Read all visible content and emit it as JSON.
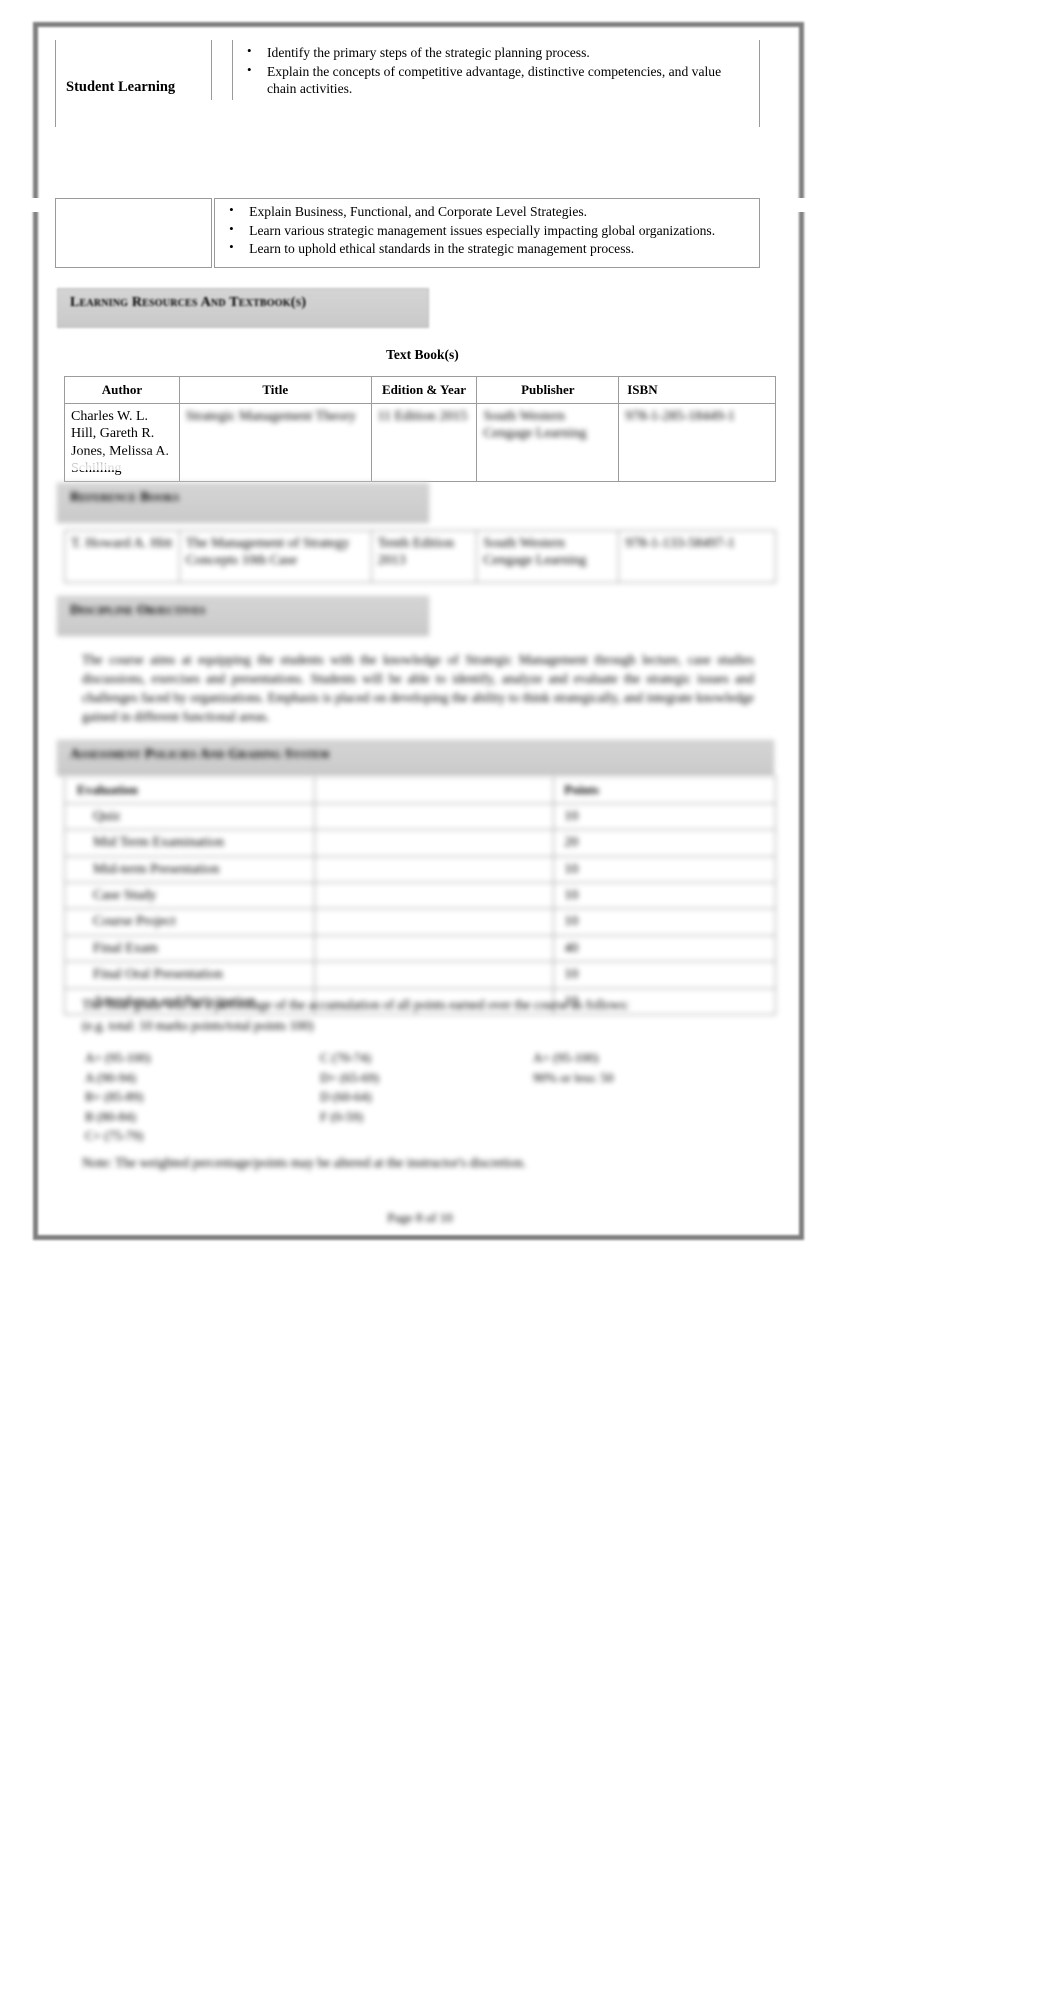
{
  "document": {
    "type": "course-syllabus-page",
    "page_number": "Page 8 of 10"
  },
  "learning_outcomes": {
    "label": "Student Learning Outcomes",
    "group1": [
      "Identify the primary steps of the strategic planning process.",
      "Explain the concepts of competitive advantage, distinctive competencies, and value chain activities."
    ],
    "group2": [
      "Explain Business, Functional, and Corporate Level Strategies.",
      "Learn various strategic management issues especially impacting global organizations.",
      "Learn to uphold ethical standards in the strategic management process."
    ]
  },
  "resources": {
    "section_title": "Learning Resources And Textbook(s)",
    "textbook_caption": "Text Book(s)",
    "columns": [
      "Author",
      "Title",
      "Edition & Year",
      "Publisher",
      "ISBN"
    ],
    "textbook_rows": [
      {
        "author": "Charles W. L. Hill, Gareth R. Jones, Melissa A. Schilling",
        "title": "Strategic Management Theory",
        "edition": "11 Edition 2015",
        "publisher": "South Western Cengage Learning",
        "isbn": "978-1-285-18449-1"
      }
    ],
    "reference_section_title": "Reference Books",
    "reference_rows": [
      {
        "author": "T. Howard A. Hitt",
        "title": "The Management of Strategy Concepts 10th Case",
        "edition": "Tenth Edition 2013",
        "publisher": "South Western Cengage Learning",
        "isbn": "978-1-133-58497-1"
      }
    ],
    "description_section_title": "Discipline Objectives",
    "description_body": "The course aims at equipping the students with the knowledge of Strategic Management through lecture, case studies discussions, exercises and presentations. Students will be able to identify, analyze and evaluate the strategic issues and challenges faced by organizations. Emphasis is placed on developing the ability to think strategically, and integrate knowledge gained in different functional areas."
  },
  "assessment": {
    "section_title": "Assessment Policies And Grading System",
    "columns": [
      "Evaluation",
      "",
      "Points"
    ],
    "rows": [
      {
        "item": "Quiz",
        "points": "10"
      },
      {
        "item": "Mid Term Examination",
        "points": "20"
      },
      {
        "item": "Mid-term Presentation",
        "points": "10"
      },
      {
        "item": "Case Study",
        "points": "10"
      },
      {
        "item": "Course Project",
        "points": "10"
      },
      {
        "item": "Final Exam",
        "points": "40"
      },
      {
        "item": "Final Oral Presentation",
        "points": "10"
      },
      {
        "item": "Attendance and Participation",
        "points": "10"
      }
    ],
    "note_line1": "The final grade will be a percentage of the accumulation of all points earned over the course as follows:",
    "note_line2": "(e.g. total: 10 marks points/total points 100)",
    "grade_scale_col1": [
      "A+ (95-100)",
      "A  (90-94)",
      "B+ (85-89)",
      "B  (80-84)",
      "C+ (75-79)"
    ],
    "grade_scale_col2": [
      "C  (70-74)",
      "D+ (65-69)",
      "D  (60-64)",
      "F  (0-59)"
    ],
    "grade_scale_col3": [
      "A+ (95-100)",
      "90% or less: 50"
    ],
    "footer_note": "Note: The weighted percentage/points may be altered at the instructor's discretion."
  }
}
